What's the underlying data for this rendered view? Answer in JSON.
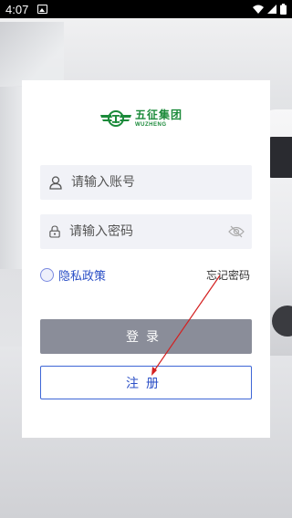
{
  "status_bar": {
    "time": "4:07"
  },
  "brand": {
    "name_cn": "五征集团",
    "name_en": "WUZHENG",
    "color": "#1b8a3a"
  },
  "login_form": {
    "username_placeholder": "请输入账号",
    "password_placeholder": "请输入密码",
    "privacy_label": "隐私政策",
    "forgot_password_label": "忘记密码",
    "login_button_label": "登录",
    "register_button_label": "注册"
  },
  "colors": {
    "accent_blue": "#2b4fc6",
    "login_button_bg": "#8a8d99",
    "annotation_red": "#d42020"
  }
}
